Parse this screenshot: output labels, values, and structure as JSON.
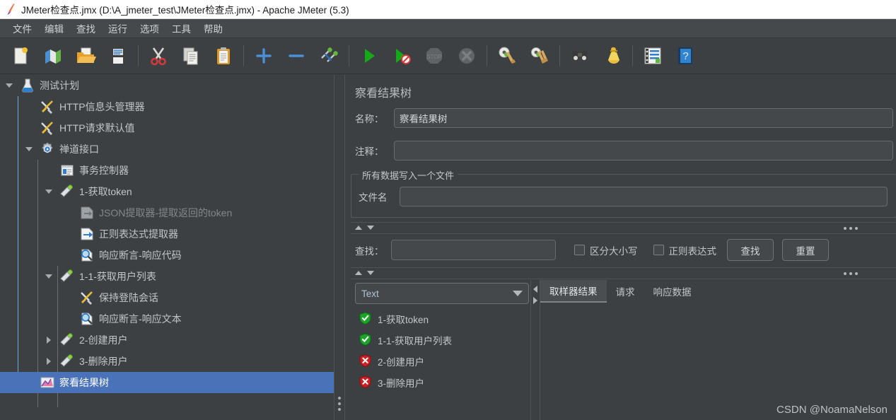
{
  "window": {
    "icon": "jmeter-feather-icon",
    "title": "JMeter检查点.jmx (D:\\A_jmeter_test\\JMeter检查点.jmx) - Apache JMeter (5.3)"
  },
  "menubar": {
    "items": [
      {
        "label": "文件",
        "name": "menu-file"
      },
      {
        "label": "编辑",
        "name": "menu-edit"
      },
      {
        "label": "查找",
        "name": "menu-search"
      },
      {
        "label": "运行",
        "name": "menu-run"
      },
      {
        "label": "选项",
        "name": "menu-options"
      },
      {
        "label": "工具",
        "name": "menu-tools"
      },
      {
        "label": "帮助",
        "name": "menu-help"
      }
    ]
  },
  "toolbar": {
    "buttons": [
      {
        "icon": "new-file-icon",
        "enabled": true
      },
      {
        "icon": "templates-icon",
        "enabled": true
      },
      {
        "icon": "open-folder-icon",
        "enabled": true
      },
      {
        "icon": "save-icon",
        "enabled": true
      },
      {
        "sep": true
      },
      {
        "icon": "cut-scissors-icon",
        "enabled": true
      },
      {
        "icon": "copy-icon",
        "enabled": true
      },
      {
        "icon": "paste-clipboard-icon",
        "enabled": true
      },
      {
        "sep": true
      },
      {
        "icon": "expand-plus-icon",
        "enabled": true
      },
      {
        "icon": "collapse-minus-icon",
        "enabled": true
      },
      {
        "icon": "toggle-enable-icon",
        "enabled": true
      },
      {
        "sep": true
      },
      {
        "icon": "start-play-icon",
        "enabled": true
      },
      {
        "icon": "start-no-pauses-icon",
        "enabled": true
      },
      {
        "icon": "stop-icon",
        "enabled": false
      },
      {
        "icon": "shutdown-icon",
        "enabled": false
      },
      {
        "sep": true
      },
      {
        "icon": "clear-icon",
        "enabled": true
      },
      {
        "icon": "clear-all-icon",
        "enabled": true
      },
      {
        "sep": true
      },
      {
        "icon": "search-binoculars-icon",
        "enabled": true
      },
      {
        "icon": "reset-search-broom-icon",
        "enabled": true
      },
      {
        "sep": true
      },
      {
        "icon": "function-helper-icon",
        "enabled": true
      },
      {
        "icon": "help-book-icon",
        "enabled": true
      }
    ]
  },
  "tree": {
    "nodes": [
      {
        "label": "测试计划",
        "icon": "test-plan-icon",
        "depth": 0,
        "twisty": "open",
        "selected": false,
        "dim": false
      },
      {
        "label": "HTTP信息头管理器",
        "icon": "config-tools-icon",
        "depth": 1,
        "twisty": "none",
        "selected": false,
        "dim": false
      },
      {
        "label": "HTTP请求默认值",
        "icon": "config-tools-icon",
        "depth": 1,
        "twisty": "none",
        "selected": false,
        "dim": false
      },
      {
        "label": "禅道接口",
        "icon": "thread-group-gear-icon",
        "depth": 1,
        "twisty": "open",
        "selected": false,
        "dim": false
      },
      {
        "label": "事务控制器",
        "icon": "transaction-controller-icon",
        "depth": 2,
        "twisty": "none",
        "selected": false,
        "dim": false
      },
      {
        "label": "1-获取token",
        "icon": "http-sampler-icon",
        "depth": 2,
        "twisty": "open",
        "selected": false,
        "dim": false
      },
      {
        "label": "JSON提取器-提取返回的token",
        "icon": "json-extractor-icon",
        "depth": 3,
        "twisty": "none",
        "selected": false,
        "dim": true
      },
      {
        "label": "正则表达式提取器",
        "icon": "regex-extractor-icon",
        "depth": 3,
        "twisty": "none",
        "selected": false,
        "dim": false
      },
      {
        "label": "响应断言-响应代码",
        "icon": "assertion-magnifier-icon",
        "depth": 3,
        "twisty": "none",
        "selected": false,
        "dim": false
      },
      {
        "label": "1-1-获取用户列表",
        "icon": "http-sampler-icon",
        "depth": 2,
        "twisty": "open",
        "selected": false,
        "dim": false
      },
      {
        "label": "保持登陆会话",
        "icon": "config-tools-icon",
        "depth": 3,
        "twisty": "none",
        "selected": false,
        "dim": false
      },
      {
        "label": "响应断言-响应文本",
        "icon": "assertion-magnifier-icon",
        "depth": 3,
        "twisty": "none",
        "selected": false,
        "dim": false
      },
      {
        "label": "2-创建用户",
        "icon": "http-sampler-icon",
        "depth": 2,
        "twisty": "closed",
        "selected": false,
        "dim": false
      },
      {
        "label": "3-删除用户",
        "icon": "http-sampler-icon",
        "depth": 2,
        "twisty": "closed",
        "selected": false,
        "dim": false
      },
      {
        "label": "察看结果树",
        "icon": "view-results-tree-icon",
        "depth": 1,
        "twisty": "none",
        "selected": true,
        "dim": false
      }
    ]
  },
  "panel": {
    "title": "察看结果树",
    "name_label": "名称：",
    "name_value": "察看结果树",
    "comment_label": "注释：",
    "comment_value": "",
    "comment_placeholder": "",
    "group_legend": "所有数据写入一个文件",
    "filename_label": "文件名",
    "filename_value": "",
    "filename_placeholder": "",
    "search_label": "查找：",
    "search_value": "",
    "search_placeholder": "",
    "case_sensitive_label": "区分大小写",
    "case_sensitive_checked": false,
    "regex_label": "正则表达式",
    "regex_checked": false,
    "search_button": "查找",
    "reset_button": "重置",
    "renderer_selected": "Text",
    "tabs": [
      {
        "label": "取样器结果",
        "active": true
      },
      {
        "label": "请求",
        "active": false
      },
      {
        "label": "响应数据",
        "active": false
      }
    ],
    "results": [
      {
        "label": "1-获取token",
        "status": "success"
      },
      {
        "label": "1-1-获取用户列表",
        "status": "success"
      },
      {
        "label": "2-创建用户",
        "status": "failure"
      },
      {
        "label": "3-删除用户",
        "status": "failure"
      }
    ]
  },
  "watermark": "CSDN @NoamaNelson",
  "colors": {
    "selection": "#4a72b8",
    "background": "#3c4043",
    "menubar": "#45494c",
    "success": "#22aa33",
    "failure": "#cc2222",
    "tree_line_root": "#6fa8dc"
  }
}
